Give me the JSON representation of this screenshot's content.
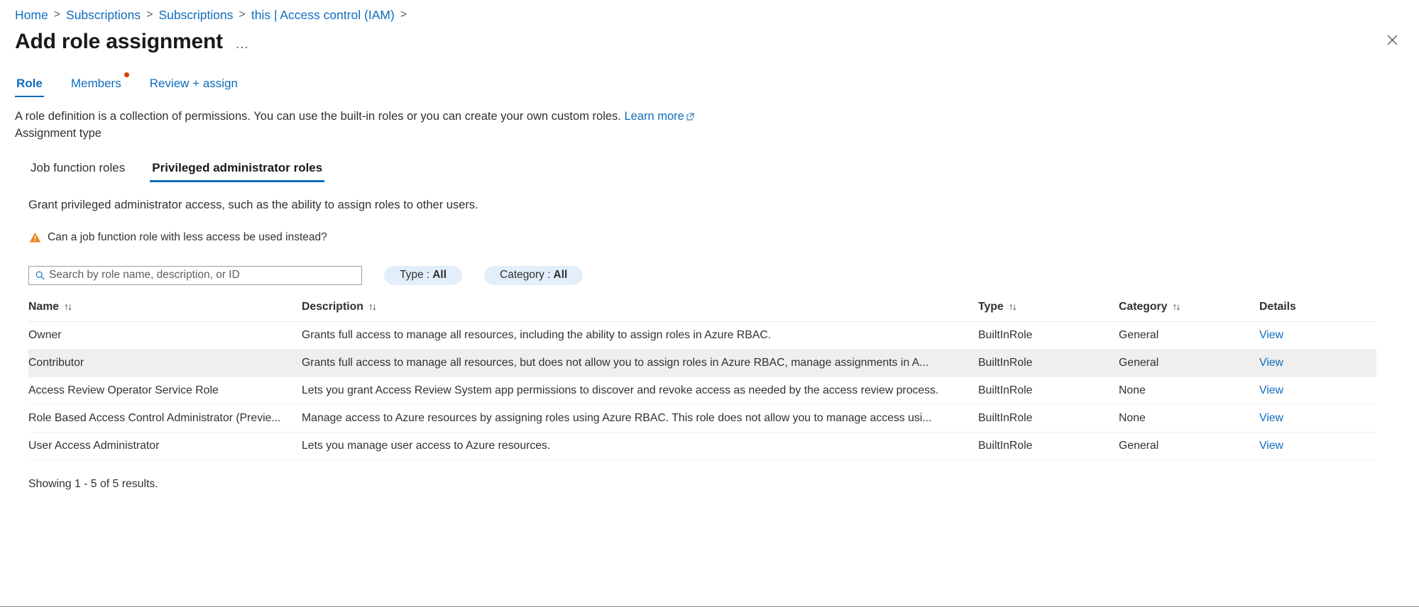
{
  "breadcrumb": {
    "items": [
      "Home",
      "Subscriptions",
      "Subscriptions",
      "this | Access control (IAM)"
    ],
    "separator": ">"
  },
  "header": {
    "title": "Add role assignment",
    "more_label": "...",
    "close_icon": "close-icon"
  },
  "tabs": [
    {
      "label": "Role",
      "active": true,
      "badge": false
    },
    {
      "label": "Members",
      "active": false,
      "badge": true
    },
    {
      "label": "Review + assign",
      "active": false,
      "badge": false
    }
  ],
  "lead": {
    "text": "A role definition is a collection of permissions. You can use the built-in roles or you can create your own custom roles.",
    "link_label": "Learn more",
    "assignment_type_label": "Assignment type"
  },
  "pivot": [
    {
      "label": "Job function roles",
      "active": false
    },
    {
      "label": "Privileged administrator roles",
      "active": true
    }
  ],
  "pivot_body": {
    "grant_text": "Grant privileged administrator access, such as the ability to assign roles to other users.",
    "warning_text": "Can a job function role with less access be used instead?",
    "warning_icon": "warning-triangle-icon"
  },
  "toolbar": {
    "search_placeholder": "Search by role name, description, or ID",
    "search_value": "",
    "search_icon": "search-icon",
    "filters": [
      {
        "label": "Type :",
        "value": "All"
      },
      {
        "label": "Category :",
        "value": "All"
      }
    ]
  },
  "table": {
    "columns": [
      {
        "label": "Name",
        "sortable": true
      },
      {
        "label": "Description",
        "sortable": true
      },
      {
        "label": "Type",
        "sortable": true
      },
      {
        "label": "Category",
        "sortable": true
      },
      {
        "label": "Details",
        "sortable": false
      }
    ],
    "sort_glyph": "↑↓",
    "rows": [
      {
        "name": "Owner",
        "description": "Grants full access to manage all resources, including the ability to assign roles in Azure RBAC.",
        "type": "BuiltInRole",
        "category": "General",
        "details": "View",
        "highlighted": false
      },
      {
        "name": "Contributor",
        "description": "Grants full access to manage all resources, but does not allow you to assign roles in Azure RBAC, manage assignments in A...",
        "type": "BuiltInRole",
        "category": "General",
        "details": "View",
        "highlighted": true
      },
      {
        "name": "Access Review Operator Service Role",
        "description": "Lets you grant Access Review System app permissions to discover and revoke access as needed by the access review process.",
        "type": "BuiltInRole",
        "category": "None",
        "details": "View",
        "highlighted": false
      },
      {
        "name": "Role Based Access Control Administrator (Previe...",
        "description": "Manage access to Azure resources by assigning roles using Azure RBAC. This role does not allow you to manage access usi...",
        "type": "BuiltInRole",
        "category": "None",
        "details": "View",
        "highlighted": false
      },
      {
        "name": "User Access Administrator",
        "description": "Lets you manage user access to Azure resources.",
        "type": "BuiltInRole",
        "category": "General",
        "details": "View",
        "highlighted": false
      }
    ],
    "results_text": "Showing 1 - 5 of 5 results."
  },
  "colors": {
    "accent": "#0f6cbd",
    "warning": "#e8871e",
    "badge": "#d83b01",
    "row_highlight": "#efefef",
    "pill_bg": "#e3eefb"
  }
}
